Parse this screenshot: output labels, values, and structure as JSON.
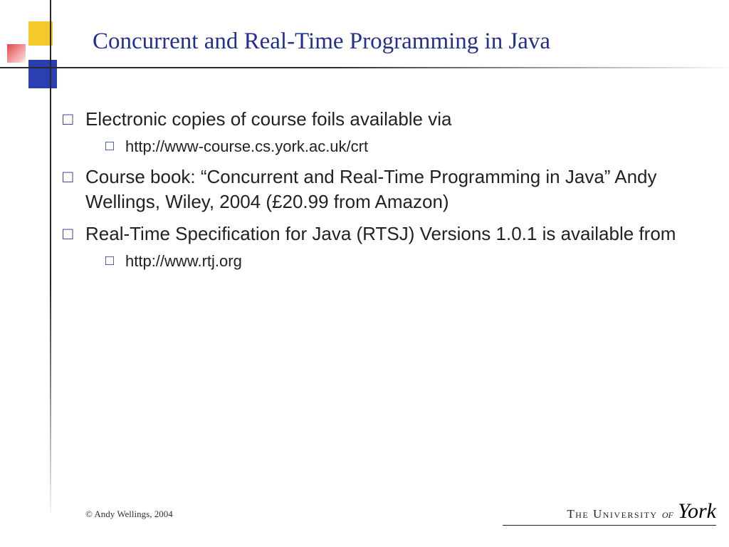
{
  "title": "Concurrent and Real-Time  Programming in Java",
  "bullets": [
    {
      "text": "Electronic copies of course foils available via",
      "sub": [
        "http://www-course.cs.york.ac.uk/crt"
      ]
    },
    {
      "text": "Course book: “Concurrent and Real-Time Programming in Java” Andy Wellings, Wiley, 2004 (£20.99 from Amazon)",
      "sub": []
    },
    {
      "text": " Real-Time Specification for Java (RTSJ)  Versions 1.0.1 is available from",
      "sub": [
        "http://www.rtj.org"
      ]
    }
  ],
  "glyphs": {
    "bullet": "□",
    "subbullet": "□"
  },
  "footer": {
    "copyright": "© Andy Wellings, 2004",
    "logo_prefix": "The University",
    "logo_of": " of ",
    "logo_name": "York"
  }
}
